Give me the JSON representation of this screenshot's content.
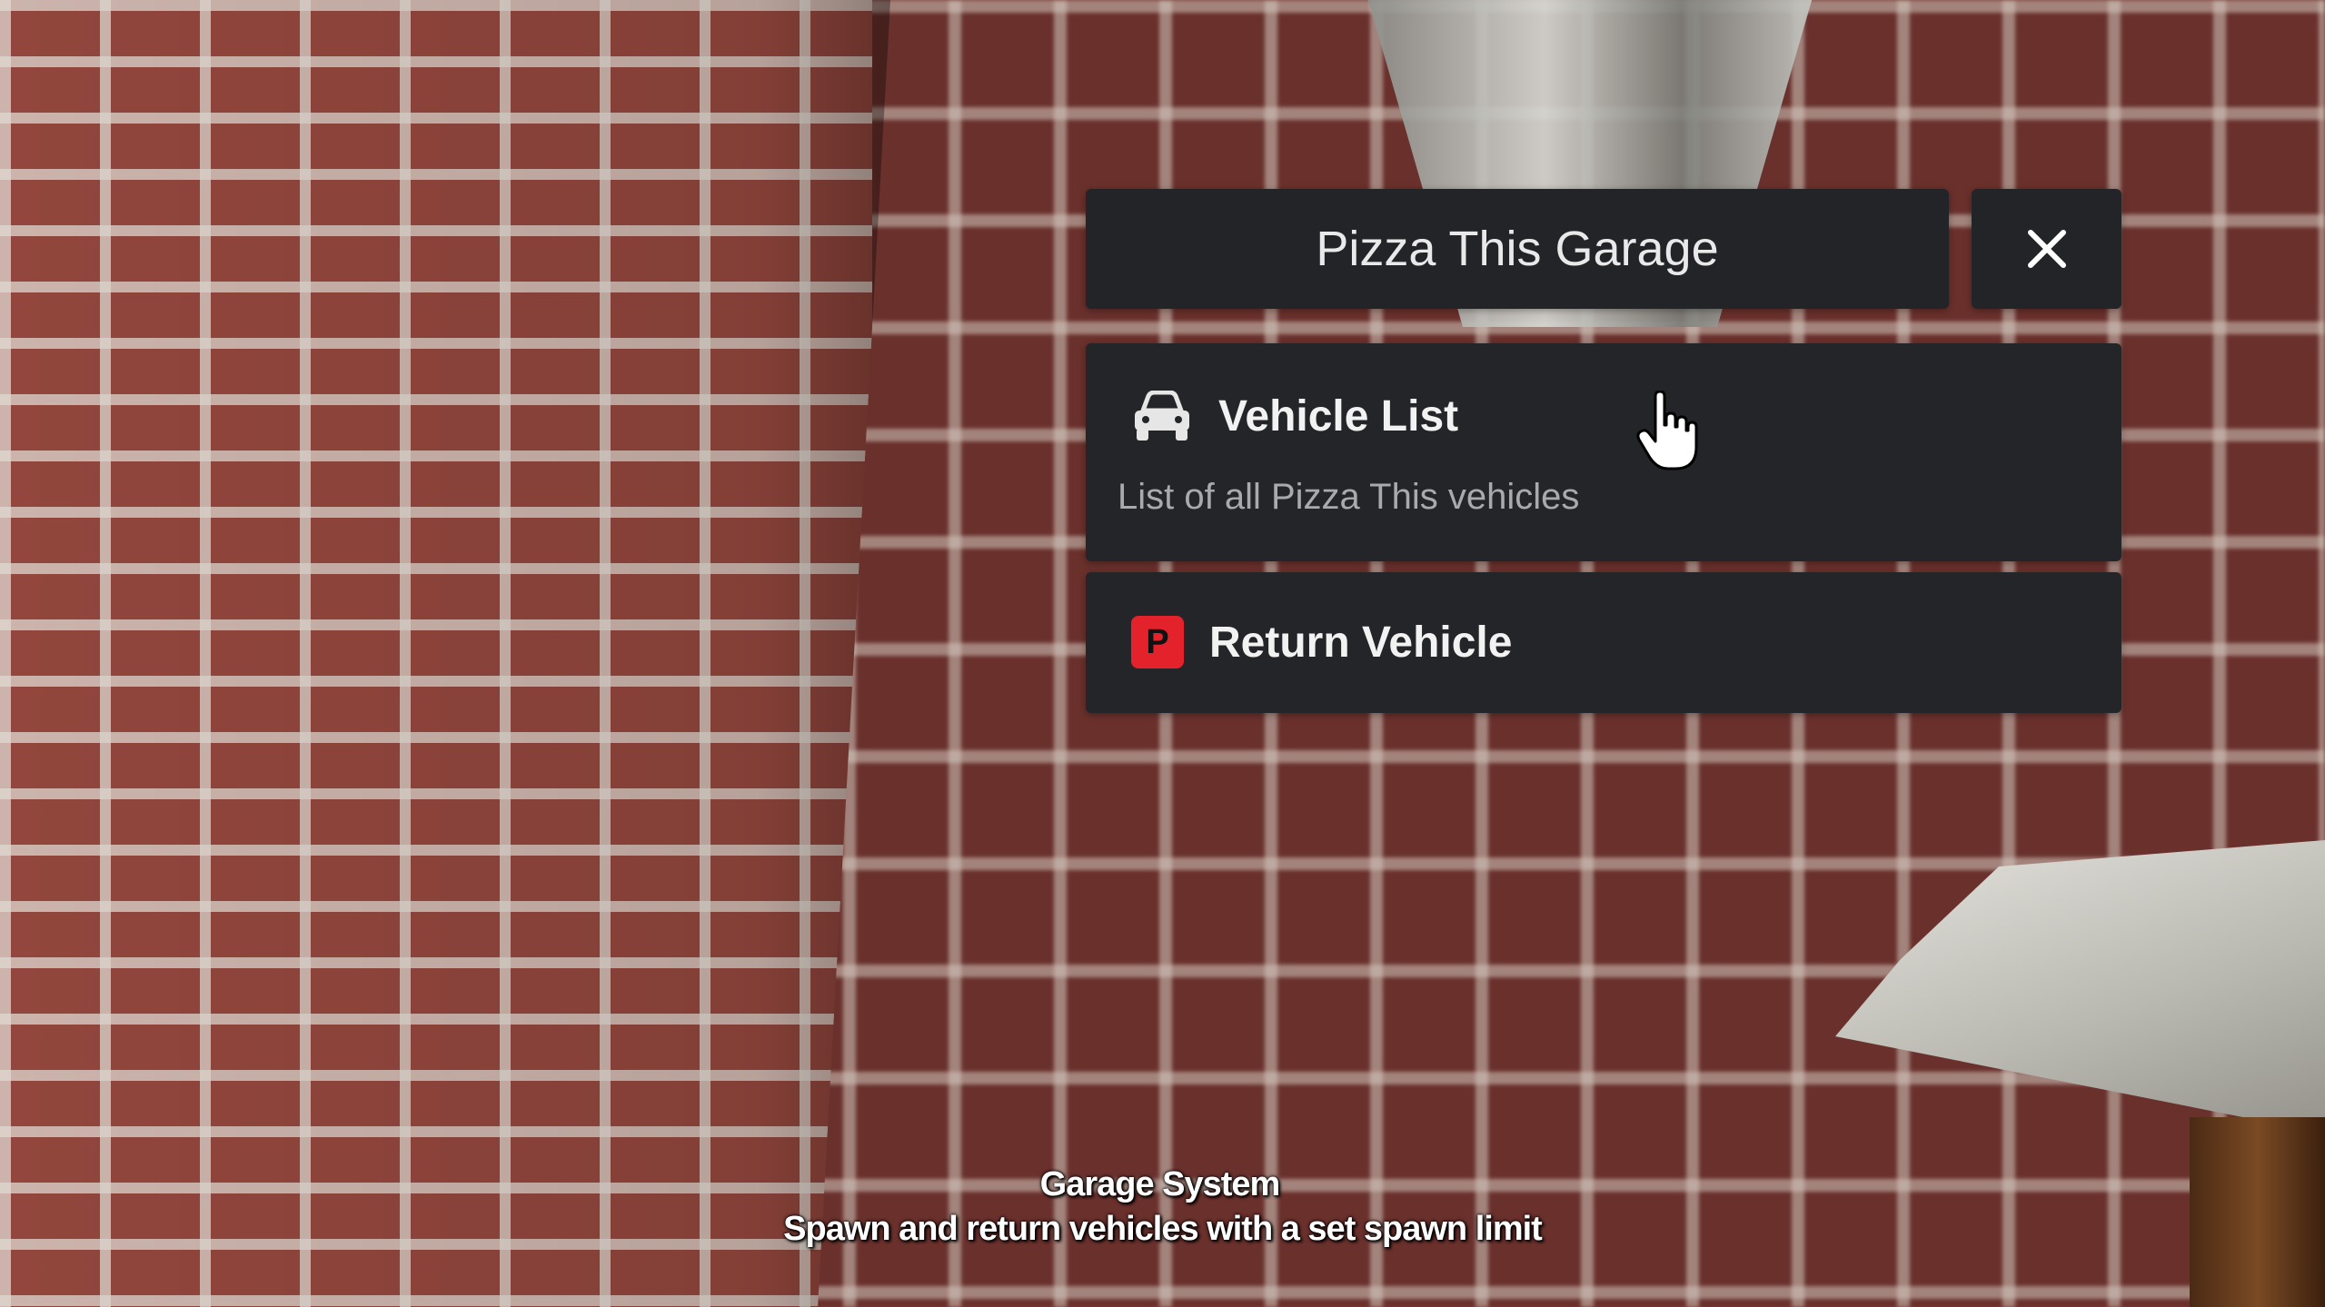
{
  "menu": {
    "title": "Pizza This Garage",
    "close_icon": "close-icon",
    "items": [
      {
        "label": "Vehicle List",
        "description": "List of all Pizza This vehicles",
        "icon": "car-icon"
      },
      {
        "label": "Return Vehicle",
        "icon": "parking-icon",
        "icon_text": "P"
      }
    ]
  },
  "caption": {
    "title": "Garage System",
    "subtitle": "Spawn and return vehicles with a set spawn limit"
  },
  "colors": {
    "panel": "#222427",
    "parking_red": "#e3222c",
    "text_primary": "#f2f2f2",
    "text_secondary": "#a9aaad"
  }
}
